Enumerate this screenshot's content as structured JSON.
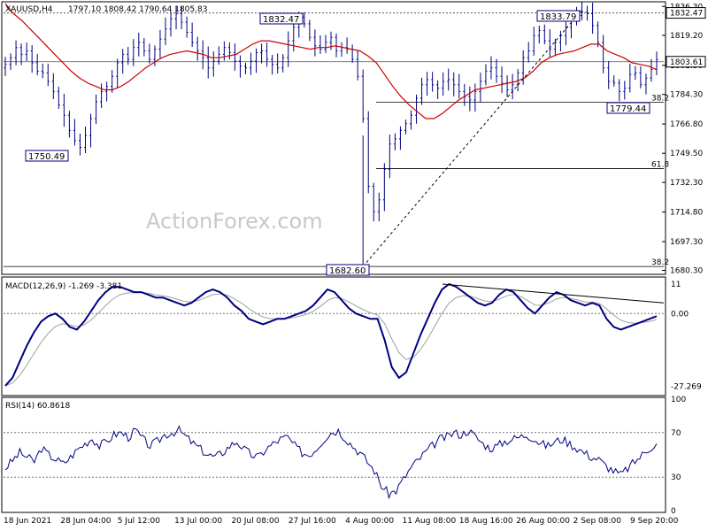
{
  "chart_data": {
    "type": "candlestick",
    "main": {
      "symbol": "XAUUSD,H4",
      "ohlc_header": "1797.10 1808.42 1790.64 1805.83",
      "watermark": "ActionForex.com",
      "y_ticks": [
        "1836.30",
        "1819.20",
        "1801.50",
        "1784.30",
        "1766.80",
        "1749.50",
        "1732.30",
        "1714.80",
        "1697.30",
        "1680.30"
      ],
      "y_range": [
        1679,
        1838
      ],
      "current_price": "1803.61",
      "annotations": {
        "high1": "1832.47",
        "high2": "1833.79",
        "low1": "1750.49",
        "low2": "1682.60",
        "low3": "1779.44",
        "right_level": "1832.47"
      },
      "fib_labels": [
        "38.2",
        "61.8",
        "38.2"
      ],
      "fib_levels": [
        1779.6,
        1740.5,
        1682.6
      ],
      "close_path": [
        1802,
        1806,
        1812,
        1808,
        1810,
        1803,
        1798,
        1797,
        1792,
        1786,
        1778,
        1772,
        1763,
        1757,
        1753,
        1760,
        1770,
        1780,
        1786,
        1789,
        1795,
        1803,
        1808,
        1805,
        1812,
        1815,
        1810,
        1805,
        1811,
        1817,
        1823,
        1829,
        1832,
        1827,
        1821,
        1815,
        1810,
        1806,
        1800,
        1804,
        1808,
        1812,
        1809,
        1804,
        1801,
        1800,
        1804,
        1809,
        1810,
        1805,
        1802,
        1800,
        1806,
        1816,
        1824,
        1830,
        1826,
        1818,
        1813,
        1811,
        1815,
        1818,
        1810,
        1812,
        1811,
        1805,
        1795,
        1770,
        1730,
        1715,
        1722,
        1740,
        1755,
        1758,
        1763,
        1767,
        1772,
        1782,
        1790,
        1793,
        1790,
        1788,
        1792,
        1793,
        1790,
        1786,
        1783,
        1781,
        1786,
        1792,
        1798,
        1800,
        1795,
        1791,
        1787,
        1790,
        1797,
        1806,
        1810,
        1819,
        1822,
        1816,
        1811,
        1815,
        1819,
        1824,
        1829,
        1831,
        1833,
        1832,
        1825,
        1815,
        1800,
        1792,
        1791,
        1786,
        1788,
        1796,
        1797,
        1790,
        1794,
        1799,
        1805
      ],
      "ma_path": [
        1838,
        1832,
        1828,
        1823,
        1818,
        1813,
        1808,
        1803,
        1798,
        1794,
        1791,
        1789,
        1787,
        1787,
        1789,
        1792,
        1796,
        1800,
        1803,
        1806,
        1808,
        1809,
        1810,
        1809,
        1808,
        1806,
        1806,
        1807,
        1808,
        1811,
        1814,
        1816,
        1816,
        1815,
        1814,
        1813,
        1812,
        1811,
        1812,
        1812,
        1813,
        1812,
        1811,
        1810,
        1807,
        1803,
        1796,
        1789,
        1783,
        1778,
        1774,
        1770,
        1770,
        1773,
        1777,
        1781,
        1784,
        1787,
        1788,
        1789,
        1790,
        1791,
        1792,
        1794,
        1798,
        1803,
        1806,
        1808,
        1809,
        1810,
        1812,
        1814,
        1814,
        1810,
        1808,
        1806,
        1803,
        1802,
        1801,
        1799
      ],
      "swing_low_idx": 67
    },
    "macd": {
      "label": "MACD(12,26,9) -1.269 -3.381",
      "y_ticks": [
        "11",
        "0.00",
        "-27.269"
      ],
      "y_range": [
        -30,
        13
      ],
      "macd": [
        -27,
        -24,
        -18,
        -12,
        -7,
        -3,
        -1,
        0,
        -2,
        -5,
        -6,
        -3,
        1,
        5,
        8,
        10,
        10,
        9,
        8,
        8,
        7,
        6,
        6,
        5,
        4,
        3,
        4,
        6,
        8,
        9,
        8,
        6,
        3,
        1,
        -2,
        -3,
        -4,
        -3,
        -2,
        -2,
        -1,
        0,
        1,
        3,
        6,
        9,
        8,
        5,
        2,
        0,
        -1,
        -2,
        -2,
        -10,
        -20,
        -24,
        -22,
        -15,
        -8,
        -2,
        4,
        9,
        11,
        10,
        8,
        6,
        4,
        3,
        4,
        7,
        9,
        8,
        5,
        2,
        0,
        3,
        6,
        8,
        7,
        5,
        4,
        3,
        4,
        3,
        -2,
        -5,
        -6,
        -5,
        -4,
        -3,
        -2,
        -1
      ],
      "trend_line_label": "",
      "y_zero_label": "0.00"
    },
    "rsi": {
      "label": "RSI(14) 60.8618",
      "y_ticks": [
        "100",
        "70",
        "30",
        "0"
      ],
      "y_range": [
        0,
        100
      ],
      "values": [
        38,
        45,
        52,
        48,
        44,
        56,
        50,
        46,
        42,
        48,
        55,
        60,
        65,
        58,
        62,
        68,
        70,
        66,
        72,
        64,
        58,
        62,
        68,
        70,
        72,
        66,
        60,
        55,
        50,
        48,
        52,
        58,
        62,
        55,
        50,
        48,
        55,
        60,
        64,
        66,
        58,
        52,
        50,
        56,
        64,
        70,
        72,
        65,
        58,
        52,
        44,
        36,
        22,
        15,
        18,
        28,
        38,
        45,
        52,
        58,
        64,
        66,
        70,
        68,
        72,
        66,
        60,
        56,
        58,
        62,
        64,
        66,
        68,
        65,
        60,
        58,
        62,
        64,
        60,
        56,
        52,
        48,
        46,
        40,
        36,
        32,
        38,
        44,
        50,
        56,
        60
      ]
    },
    "x_ticks": [
      "18 Jun 2021",
      "28 Jun 04:00",
      "5 Jul 12:00",
      "13 Jul 00:00",
      "20 Jul 08:00",
      "27 Jul 16:00",
      "4 Aug 00:00",
      "11 Aug 08:00",
      "18 Aug 16:00",
      "26 Aug 00:00",
      "2 Sep 08:00",
      "9 Sep 20:00"
    ],
    "colors": {
      "candle": "#000080",
      "ma": "#cc0000",
      "macd": "#000080",
      "signal": "#a0a0a0",
      "grid": "#b4b4b4",
      "trend": "#000000"
    }
  }
}
